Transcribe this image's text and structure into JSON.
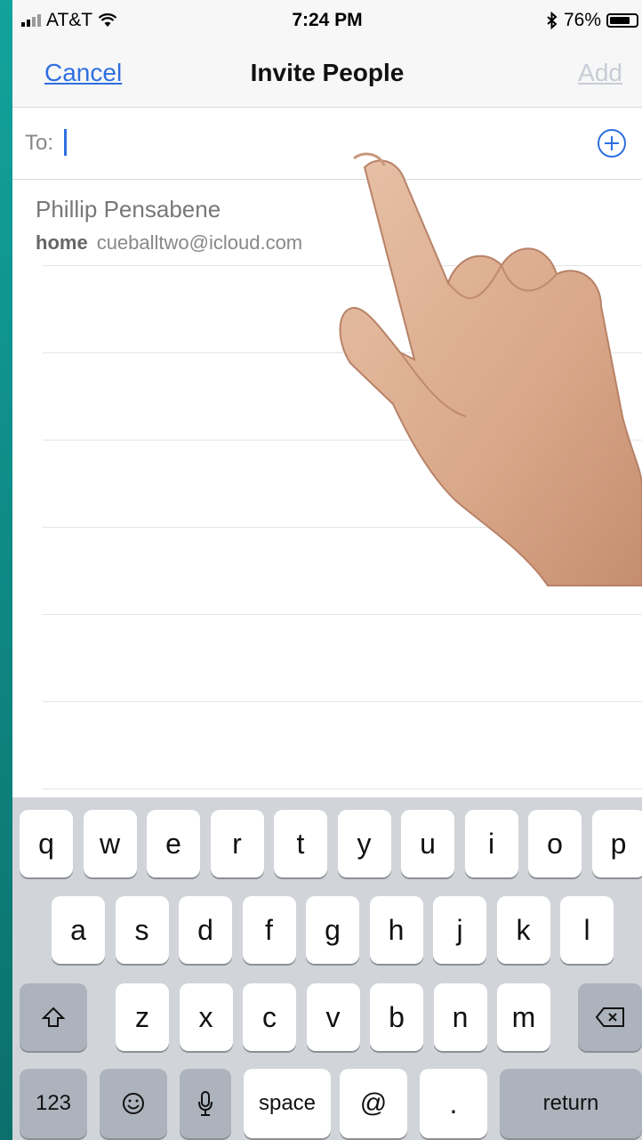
{
  "status_bar": {
    "carrier": "AT&T",
    "time": "7:24 PM",
    "battery": "76%"
  },
  "nav": {
    "cancel_label": "Cancel",
    "title": "Invite People",
    "add_label": "Add"
  },
  "to_field": {
    "label": "To:",
    "value": ""
  },
  "suggestions": [
    {
      "name": "Phillip Pensabene",
      "type": "home",
      "email": "cueballtwo@icloud.com"
    }
  ],
  "keyboard": {
    "row1": [
      "q",
      "w",
      "e",
      "r",
      "t",
      "y",
      "u",
      "i",
      "o",
      "p"
    ],
    "row2": [
      "a",
      "s",
      "d",
      "f",
      "g",
      "h",
      "j",
      "k",
      "l"
    ],
    "row3": [
      "z",
      "x",
      "c",
      "v",
      "b",
      "n",
      "m"
    ],
    "numbers_label": "123",
    "space_label": "space",
    "at_label": "@",
    "period_label": ".",
    "return_label": "return"
  },
  "colors": {
    "accent": "#2f6fe0",
    "background": "#0e8a86",
    "keyboard": "#d1d4d9"
  }
}
